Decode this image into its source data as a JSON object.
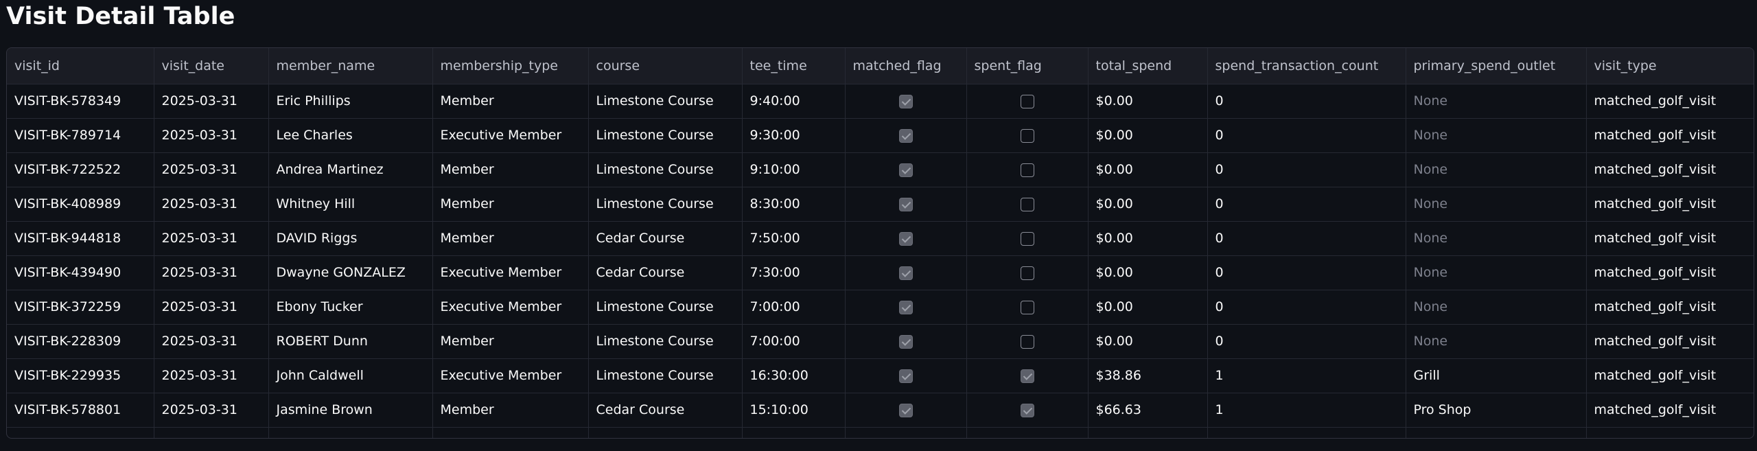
{
  "title": "Visit Detail Table",
  "table": {
    "columns": [
      {
        "key": "visit_id",
        "label": "visit_id"
      },
      {
        "key": "visit_date",
        "label": "visit_date"
      },
      {
        "key": "member_name",
        "label": "member_name"
      },
      {
        "key": "membership_type",
        "label": "membership_type"
      },
      {
        "key": "course",
        "label": "course"
      },
      {
        "key": "tee_time",
        "label": "tee_time"
      },
      {
        "key": "matched_flag",
        "label": "matched_flag"
      },
      {
        "key": "spent_flag",
        "label": "spent_flag"
      },
      {
        "key": "total_spend",
        "label": "total_spend"
      },
      {
        "key": "spend_transaction_count",
        "label": "spend_transaction_count"
      },
      {
        "key": "primary_spend_outlet",
        "label": "primary_spend_outlet"
      },
      {
        "key": "visit_type",
        "label": "visit_type"
      }
    ],
    "rows": [
      {
        "visit_id": "VISIT-BK-578349",
        "visit_date": "2025-03-31",
        "member_name": "Eric Phillips",
        "membership_type": "Member",
        "course": "Limestone Course",
        "tee_time": "9:40:00",
        "matched_flag": true,
        "spent_flag": false,
        "total_spend": "$0.00",
        "spend_transaction_count": "0",
        "primary_spend_outlet": "None",
        "visit_type": "matched_golf_visit"
      },
      {
        "visit_id": "VISIT-BK-789714",
        "visit_date": "2025-03-31",
        "member_name": "Lee Charles",
        "membership_type": "Executive Member",
        "course": "Limestone Course",
        "tee_time": "9:30:00",
        "matched_flag": true,
        "spent_flag": false,
        "total_spend": "$0.00",
        "spend_transaction_count": "0",
        "primary_spend_outlet": "None",
        "visit_type": "matched_golf_visit"
      },
      {
        "visit_id": "VISIT-BK-722522",
        "visit_date": "2025-03-31",
        "member_name": "Andrea Martinez",
        "membership_type": "Member",
        "course": "Limestone Course",
        "tee_time": "9:10:00",
        "matched_flag": true,
        "spent_flag": false,
        "total_spend": "$0.00",
        "spend_transaction_count": "0",
        "primary_spend_outlet": "None",
        "visit_type": "matched_golf_visit"
      },
      {
        "visit_id": "VISIT-BK-408989",
        "visit_date": "2025-03-31",
        "member_name": "Whitney Hill",
        "membership_type": "Member",
        "course": "Limestone Course",
        "tee_time": "8:30:00",
        "matched_flag": true,
        "spent_flag": false,
        "total_spend": "$0.00",
        "spend_transaction_count": "0",
        "primary_spend_outlet": "None",
        "visit_type": "matched_golf_visit"
      },
      {
        "visit_id": "VISIT-BK-944818",
        "visit_date": "2025-03-31",
        "member_name": "DAVID Riggs",
        "membership_type": "Member",
        "course": "Cedar Course",
        "tee_time": "7:50:00",
        "matched_flag": true,
        "spent_flag": false,
        "total_spend": "$0.00",
        "spend_transaction_count": "0",
        "primary_spend_outlet": "None",
        "visit_type": "matched_golf_visit"
      },
      {
        "visit_id": "VISIT-BK-439490",
        "visit_date": "2025-03-31",
        "member_name": "Dwayne GONZALEZ",
        "membership_type": "Executive Member",
        "course": "Cedar Course",
        "tee_time": "7:30:00",
        "matched_flag": true,
        "spent_flag": false,
        "total_spend": "$0.00",
        "spend_transaction_count": "0",
        "primary_spend_outlet": "None",
        "visit_type": "matched_golf_visit"
      },
      {
        "visit_id": "VISIT-BK-372259",
        "visit_date": "2025-03-31",
        "member_name": "Ebony Tucker",
        "membership_type": "Executive Member",
        "course": "Limestone Course",
        "tee_time": "7:00:00",
        "matched_flag": true,
        "spent_flag": false,
        "total_spend": "$0.00",
        "spend_transaction_count": "0",
        "primary_spend_outlet": "None",
        "visit_type": "matched_golf_visit"
      },
      {
        "visit_id": "VISIT-BK-228309",
        "visit_date": "2025-03-31",
        "member_name": "ROBERT Dunn",
        "membership_type": "Member",
        "course": "Limestone Course",
        "tee_time": "7:00:00",
        "matched_flag": true,
        "spent_flag": false,
        "total_spend": "$0.00",
        "spend_transaction_count": "0",
        "primary_spend_outlet": "None",
        "visit_type": "matched_golf_visit"
      },
      {
        "visit_id": "VISIT-BK-229935",
        "visit_date": "2025-03-31",
        "member_name": "John Caldwell",
        "membership_type": "Executive Member",
        "course": "Limestone Course",
        "tee_time": "16:30:00",
        "matched_flag": true,
        "spent_flag": true,
        "total_spend": "$38.86",
        "spend_transaction_count": "1",
        "primary_spend_outlet": "Grill",
        "visit_type": "matched_golf_visit"
      },
      {
        "visit_id": "VISIT-BK-578801",
        "visit_date": "2025-03-31",
        "member_name": "Jasmine Brown",
        "membership_type": "Member",
        "course": "Cedar Course",
        "tee_time": "15:10:00",
        "matched_flag": true,
        "spent_flag": true,
        "total_spend": "$66.63",
        "spend_transaction_count": "1",
        "primary_spend_outlet": "Pro Shop",
        "visit_type": "matched_golf_visit"
      }
    ],
    "partial_row": {
      "matched_flag": true,
      "spent_flag": false
    }
  }
}
